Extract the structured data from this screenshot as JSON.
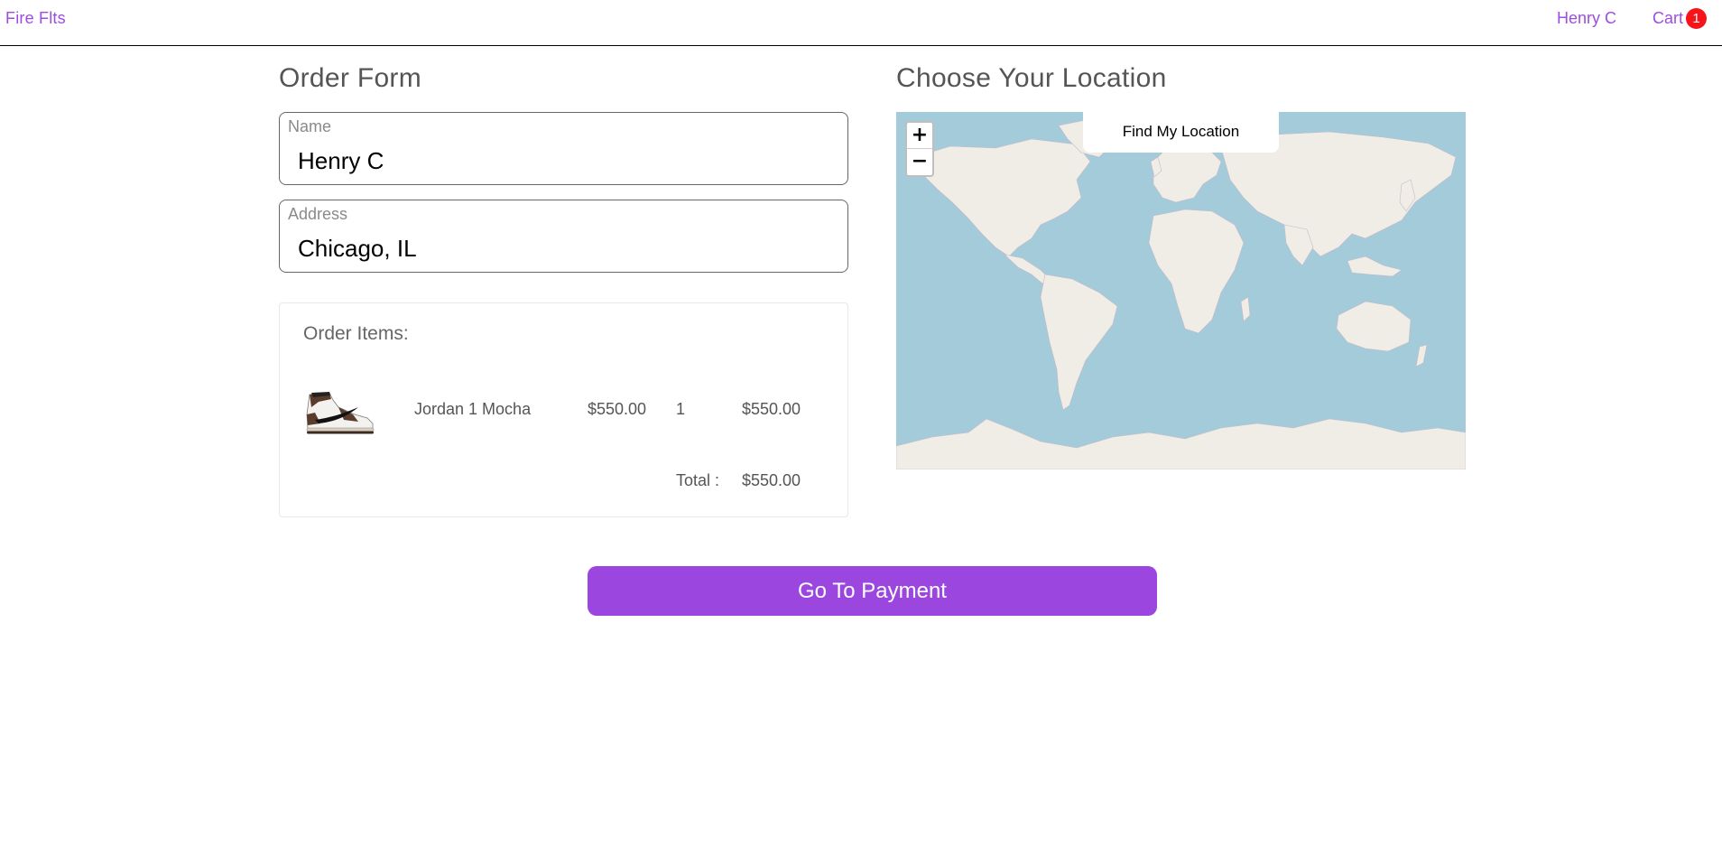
{
  "nav": {
    "brand": "Fire Flts",
    "user": "Henry C",
    "cart_label": "Cart",
    "cart_count": "1"
  },
  "order_form": {
    "heading": "Order Form",
    "name_label": "Name",
    "name_value": "Henry C",
    "address_label": "Address",
    "address_value": "Chicago, IL"
  },
  "order_items": {
    "title": "Order Items:",
    "items": [
      {
        "name": "Jordan 1 Mocha",
        "price": "$550.00",
        "quantity": "1",
        "line_total": "$550.00"
      }
    ],
    "total_label": "Total :",
    "total_value": "$550.00"
  },
  "location": {
    "heading": "Choose Your Location",
    "find_button": "Find My Location",
    "zoom_in": "+",
    "zoom_out": "−"
  },
  "payment": {
    "button_label": "Go To Payment"
  },
  "colors": {
    "accent": "#9b47df",
    "badge": "#f8121a",
    "water": "#a3cbd9",
    "land": "#efede6"
  }
}
